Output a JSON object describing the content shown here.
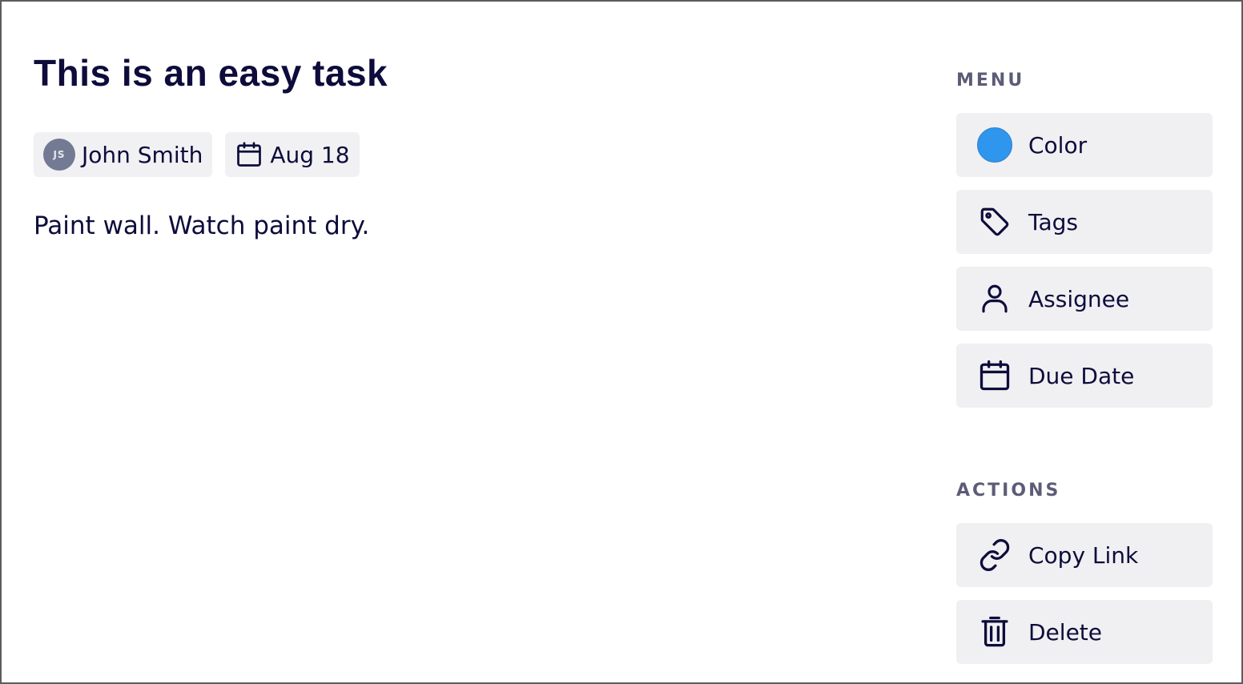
{
  "task": {
    "title": "This is an easy task",
    "assignee": {
      "initials": "JS",
      "name": "John Smith"
    },
    "due_date": "Aug 18",
    "description": "Paint wall. Watch paint dry."
  },
  "menu": {
    "heading": "MENU",
    "items": [
      {
        "label": "Color",
        "icon": "color-swatch",
        "color": "#2e96ec"
      },
      {
        "label": "Tags",
        "icon": "tag-icon"
      },
      {
        "label": "Assignee",
        "icon": "user-icon"
      },
      {
        "label": "Due Date",
        "icon": "calendar-icon"
      }
    ]
  },
  "actions": {
    "heading": "ACTIONS",
    "items": [
      {
        "label": "Copy Link",
        "icon": "link-icon"
      },
      {
        "label": "Delete",
        "icon": "trash-icon"
      }
    ]
  },
  "colors": {
    "text": "#0d0c3b",
    "muted": "#5d5c77",
    "chip_bg": "#f1f1f3",
    "button_bg": "#f0f0f2",
    "accent": "#2e96ec",
    "avatar_bg": "#737a93"
  }
}
